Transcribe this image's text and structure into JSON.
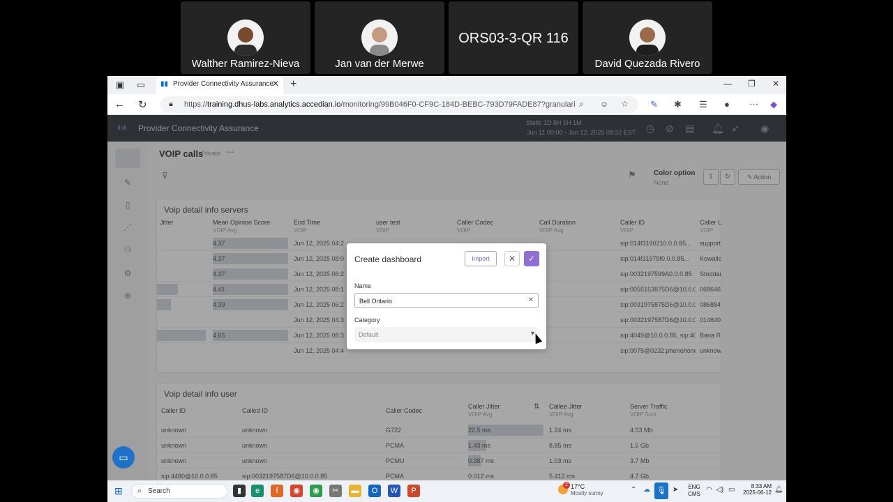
{
  "participants": [
    {
      "name": "Walther Ramirez-Nieva",
      "avatar": true
    },
    {
      "name": "Jan van der Merwe",
      "avatar": true
    },
    {
      "name": "ORS03-3-QR 116",
      "avatar": false
    },
    {
      "name": "David Quezada Rivero",
      "avatar": true
    }
  ],
  "browser": {
    "tab_title": "Provider Connectivity Assurance",
    "url_prefix": "https://",
    "url_domain": "training.dhus-labs.analytics.accedian.io",
    "url_path": "/monitoring/99B046F0-CF9C-184D-BEBC-793D79FADE87?granularity..."
  },
  "app": {
    "name": "Provider Connectivity Assurance",
    "granularity": "Static   1D 8H  1H   1M",
    "date_range": "Jun 11 00:00 - Jun 12, 2025 08:32 EST",
    "page_title": "VOIP calls",
    "page_visibility": "Private",
    "color_option_label": "Color option",
    "color_option_value": "None",
    "action_label": "Action"
  },
  "panel_servers": {
    "title": "Voip detail info servers",
    "columns": [
      {
        "name": "Jitter",
        "sub": ""
      },
      {
        "name": "Mean Opinion Score",
        "sub": "VOIP Avg"
      },
      {
        "name": "End Time",
        "sub": "VOIP"
      },
      {
        "name": "user test",
        "sub": "VOIP"
      },
      {
        "name": "Caller Codec",
        "sub": "VOIP"
      },
      {
        "name": "Call Duration",
        "sub": "VOIP Avg"
      },
      {
        "name": "Caller ID",
        "sub": "VOIP"
      },
      {
        "name": "Caller L",
        "sub": "VOIP"
      }
    ],
    "rows": [
      {
        "mos": "4.37",
        "end": "Jun 12, 2025 04:2",
        "caller": "sip:014f3190210.0.0.85...",
        "tail": "support"
      },
      {
        "mos": "4.37",
        "end": "Jun 12, 2025 08:0",
        "caller": "sip:014f31975f0.0.0.85...",
        "tail": "Kowalle"
      },
      {
        "mos": "4.37",
        "end": "Jun 12, 2025 06:2",
        "caller": "sip:0032197599A0.0.0.85",
        "tail": "Stoddar"
      },
      {
        "mos": "4.41",
        "end": "Jun 12, 2025 08:1",
        "caller": "sip:0055153875D6@10.0.0.85",
        "tail": "0686462"
      },
      {
        "mos": "4.39",
        "end": "Jun 12, 2025 06:2",
        "caller": "sip:0031975875D6@10.0.0.85",
        "tail": "0868842"
      },
      {
        "mos": "",
        "end": "Jun 12, 2025 04:3",
        "caller": "sip:0032197587D6@10.0.0.85",
        "tail": "0148401"
      },
      {
        "mos": "4.65",
        "end": "Jun 12, 2025 08:3",
        "caller": "sip:4049@10.0.0.85, sip:4078",
        "tail": "Bana Ro"
      },
      {
        "mos": "",
        "end": "Jun 12, 2025 04:4",
        "caller": "sip:0075@0232.phenohone.c",
        "tail": "unknown"
      }
    ]
  },
  "panel_user": {
    "title": "Voip detail info user",
    "columns": [
      {
        "name": "Caller ID",
        "sub": ""
      },
      {
        "name": "Called ID",
        "sub": ""
      },
      {
        "name": "Caller Codec",
        "sub": ""
      },
      {
        "name": "Caller Jitter",
        "sub": "VOIP Avg"
      },
      {
        "name": "Callee Jitter",
        "sub": "VOIP Avg"
      },
      {
        "name": "Server Traffic",
        "sub": "VOIP Sum"
      }
    ],
    "rows": [
      {
        "caller": "unknown",
        "called": "unknown",
        "codec": "G722",
        "cj": "22.5 ms",
        "ej": "1.24 ms",
        "tr": "4.53 Mb"
      },
      {
        "caller": "unknown",
        "called": "unknown",
        "codec": "PCMA",
        "cj": "1.43 ms",
        "ej": "8.85 ms",
        "tr": "1.5 Gb"
      },
      {
        "caller": "unknown",
        "called": "unknown",
        "codec": "PCMU",
        "cj": "0.987 ms",
        "ej": "1.03 ms",
        "tr": "3.7 Mb"
      },
      {
        "caller": "sip:4480@10.0.0.85",
        "called": "sip:0032197587D6@10.0.0.85",
        "codec": "PCMA",
        "cj": "0.012 ms",
        "ej": "5.412 ms",
        "tr": "4.7 Gb"
      }
    ]
  },
  "modal": {
    "title": "Create dashboard",
    "import_label": "Import",
    "name_label": "Name",
    "name_value": "Bell Ontario",
    "category_label": "Category",
    "category_value": "Default"
  },
  "taskbar": {
    "search_label": "Search",
    "weather_temp": "17°C",
    "weather_desc": "Mostly sunny",
    "weather_badge": "2",
    "lang_top": "ENG",
    "lang_bottom": "CMS",
    "time": "8:33 AM",
    "date": "2025-06-12"
  },
  "colors": {
    "accent": "#8f6ed5",
    "brand_blue": "#1f72c9",
    "app_header": "#222831"
  }
}
